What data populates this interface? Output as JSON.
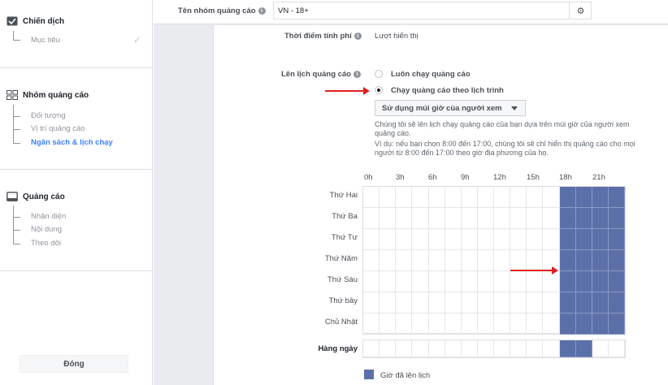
{
  "sidebar": {
    "campaign": {
      "title": "Chiến dịch",
      "items": [
        "Mục tiêu"
      ]
    },
    "adset": {
      "title": "Nhóm quảng cáo",
      "items": [
        "Đối tượng",
        "Vị trí quảng cáo",
        "Ngân sách & lịch chạy"
      ],
      "active_index": 2
    },
    "ad": {
      "title": "Quảng cáo",
      "items": [
        "Nhận diện",
        "Nội dung",
        "Theo dõi"
      ]
    },
    "close_label": "Đóng"
  },
  "adset_name": {
    "label": "Tên nhóm quảng cáo",
    "value": "VN - 18+"
  },
  "billing": {
    "label": "Thời điểm tính phí",
    "value": "Lượt hiển thị"
  },
  "schedule": {
    "label": "Lên lịch quảng cáo",
    "options": [
      "Luôn chạy quảng cáo",
      "Chạy quảng cáo theo lịch trình"
    ],
    "selected_index": 1,
    "timezone_select": "Sử dụng múi giờ của người xem",
    "desc1": "Chúng tôi sẽ lên lịch chạy quảng cáo của bạn dựa trên múi giờ của người xem quảng cáo.",
    "desc2": "Ví dụ: nếu bạn chọn 8:00 đến 17:00, chúng tôi sẽ chỉ hiển thị quảng cáo cho mọi người từ 8:00 đến 17:00 theo giờ địa phương của họ."
  },
  "grid": {
    "hour_labels": [
      "0h",
      "3h",
      "6h",
      "9h",
      "12h",
      "15h",
      "18h",
      "21h"
    ],
    "days": [
      "Thứ Hai",
      "Thứ Ba",
      "Thứ Tư",
      "Thứ Năm",
      "Thứ Sáu",
      "Thứ bảy",
      "Chủ Nhật"
    ],
    "daily_label": "Hàng ngày",
    "active_blocks": [
      18,
      19
    ],
    "legend": "Giờ đã lên lịch",
    "active_color": "#5b6fa8"
  },
  "accent_color": "#4080ff"
}
